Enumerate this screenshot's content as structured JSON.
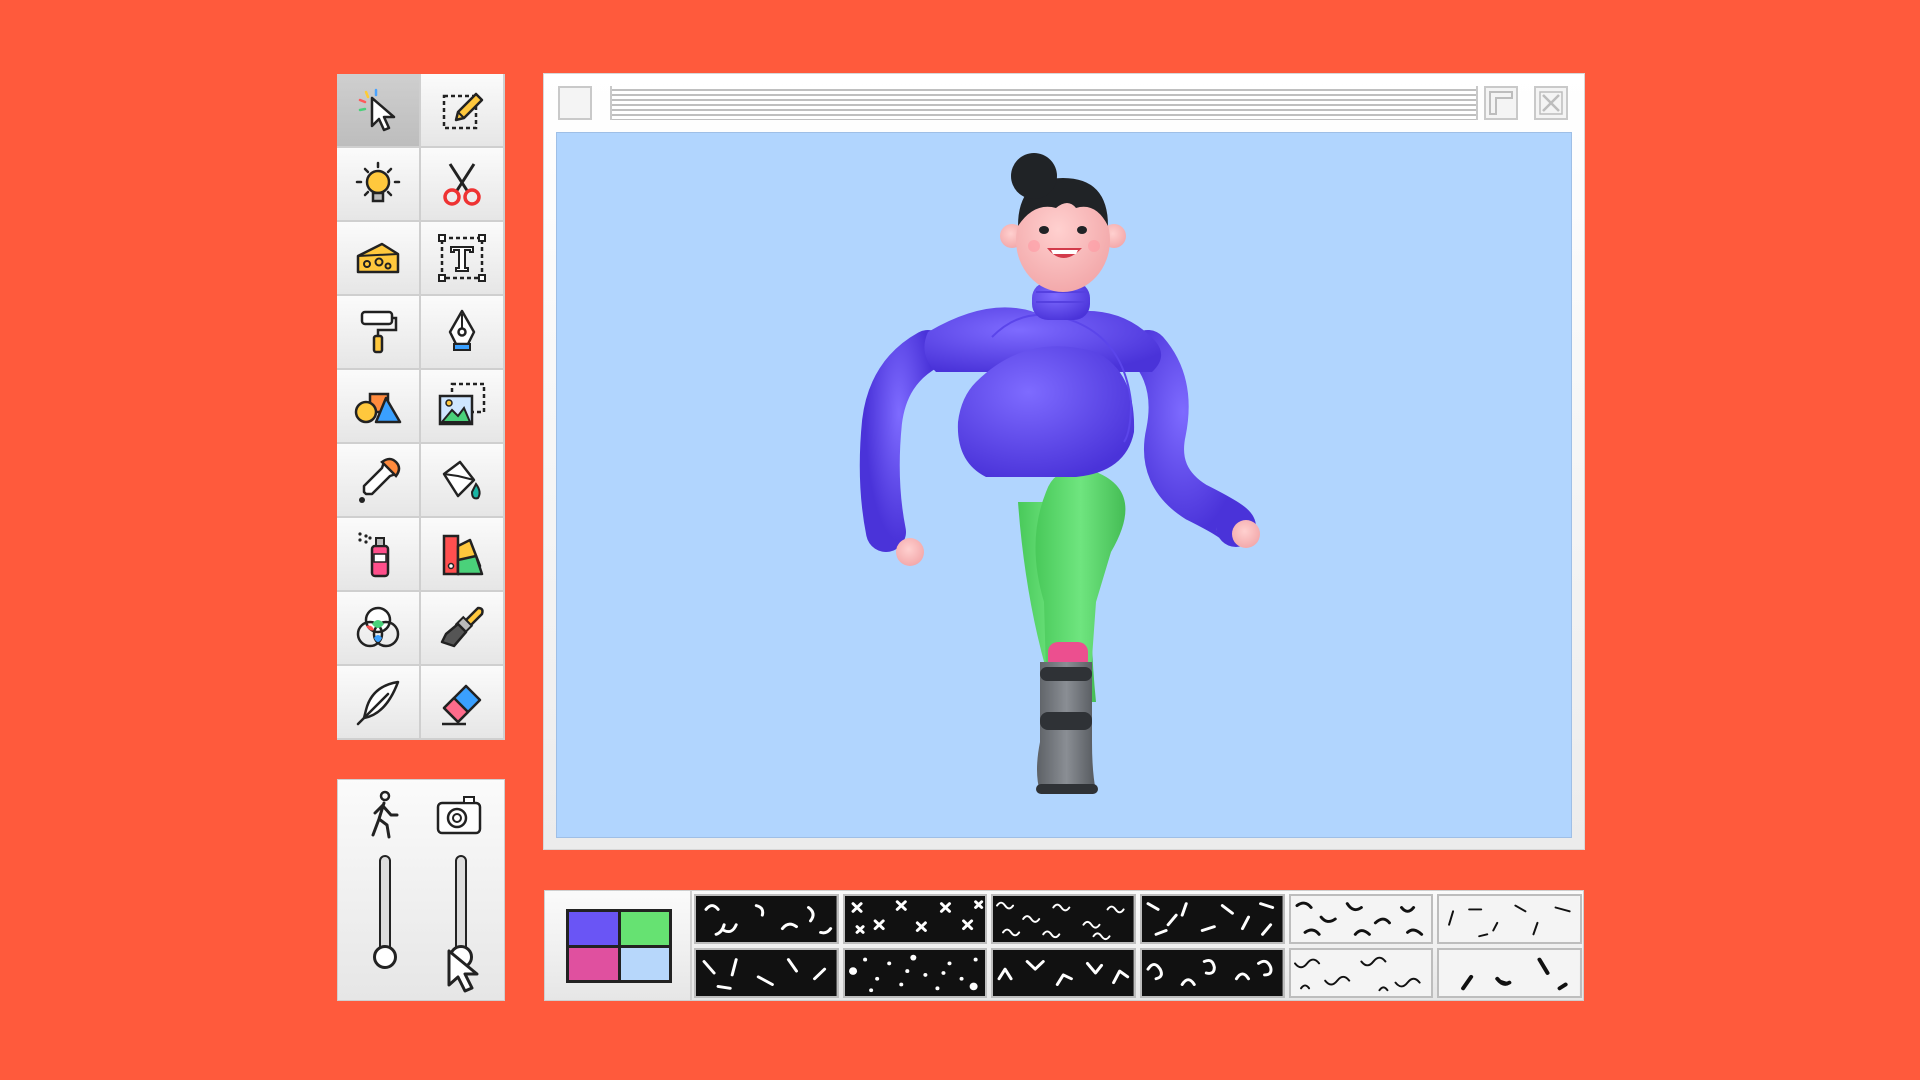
{
  "app": {
    "background_color": "#ff5a3c",
    "canvas_color": "#b1d5fe"
  },
  "toolbar": {
    "tools": [
      {
        "name": "select-cursor-icon",
        "active": true
      },
      {
        "name": "edit-pencil-icon"
      },
      {
        "name": "lightbulb-icon"
      },
      {
        "name": "scissors-icon"
      },
      {
        "name": "cheese-icon"
      },
      {
        "name": "text-box-icon"
      },
      {
        "name": "paint-roller-icon"
      },
      {
        "name": "pen-nib-icon"
      },
      {
        "name": "shapes-icon"
      },
      {
        "name": "image-icon"
      },
      {
        "name": "eyedropper-icon"
      },
      {
        "name": "paint-bucket-icon"
      },
      {
        "name": "spray-can-icon"
      },
      {
        "name": "color-swatches-icon"
      },
      {
        "name": "rgb-circles-icon"
      },
      {
        "name": "brush-icon"
      },
      {
        "name": "feather-icon"
      },
      {
        "name": "eraser-icon"
      }
    ]
  },
  "sliders": [
    {
      "icon": "walking-person-icon",
      "value": 0.0
    },
    {
      "icon": "camera-icon",
      "value": 0.0
    }
  ],
  "swatches": [
    "#6a55f5",
    "#66e272",
    "#e0509f",
    "#b7d7fb"
  ],
  "patterns": [
    "black-white-arcs",
    "black-white-crosses",
    "black-white-squiggles",
    "black-white-confetti",
    "white-black-worms",
    "white-black-dashes",
    "black-white-lines",
    "black-white-dots",
    "black-white-zigzags",
    "black-white-curls",
    "white-black-scribbles",
    "white-black-strokes"
  ]
}
